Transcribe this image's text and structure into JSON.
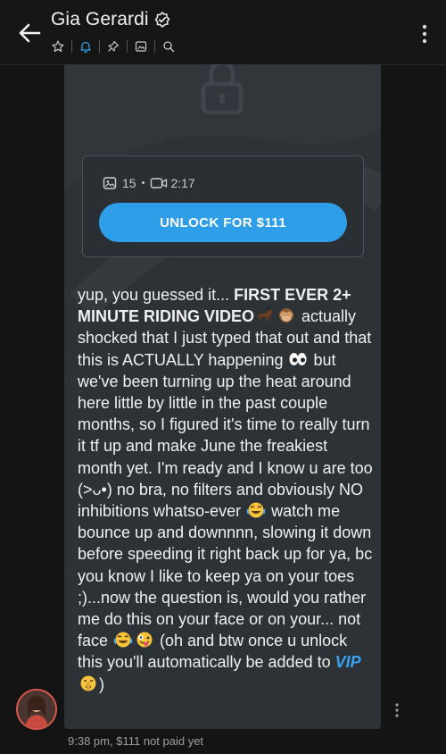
{
  "header": {
    "title": "Gia Gerardi",
    "icons": [
      "star-icon",
      "bell-icon",
      "pin-icon",
      "image-icon",
      "search-icon"
    ]
  },
  "post": {
    "photo_count": "15",
    "dot": "•",
    "video_duration": "2:17",
    "unlock_label": "UNLOCK FOR $111",
    "text_parts": {
      "p1": "yup, you guessed it... ",
      "p2": "FIRST EVER 2+ MINUTE RIDING VIDEO",
      "p3": " actually shocked that I just typed that out and that this is ACTUALLY happening ",
      "p4": " but we've been turning up the heat around here little by little in the past couple months, so I figured it's time to really turn it tf up and make June the freakiest month yet. I'm ready and I know u are too (>ᴗ•) no bra, no filters and obviously NO inhibitions whatso-ever ",
      "p5": " watch me bounce up and downnnn, slowing it down before speeding it right back up for ya, bc you know I like to keep ya on your toes ;)...now the question is, would you rather me do this on your face or on your... not face ",
      "p6": " (oh and btw once u unlock this you'll automatically be added to ",
      "vip": "VIP",
      "p7": ")"
    }
  },
  "meta": {
    "time": "9:38 pm,",
    "price_status": "$111 not paid yet"
  },
  "colors": {
    "accent": "#2f9ee9",
    "bubble": "#2d3236",
    "background": "#141414"
  }
}
